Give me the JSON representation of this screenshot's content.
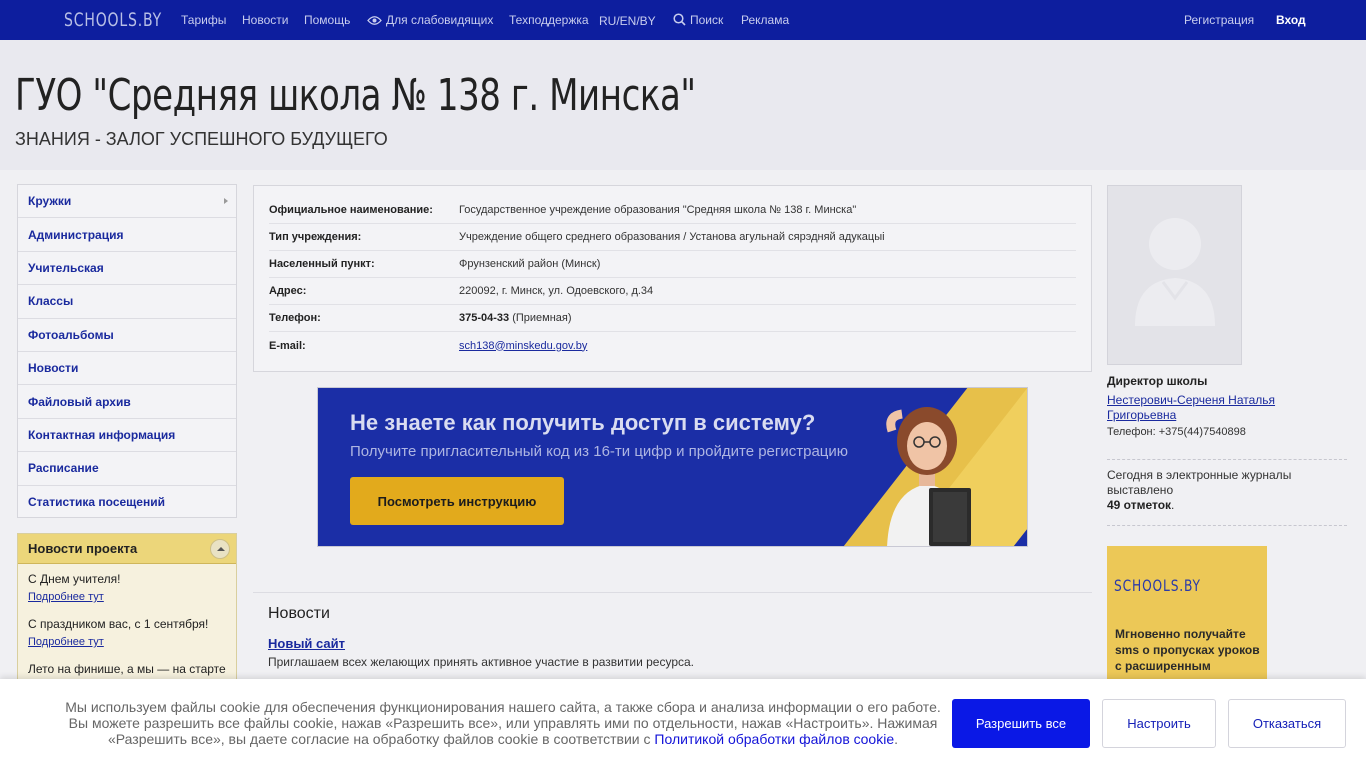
{
  "topbar": {
    "logo": "SCHOOLS.BY",
    "nav": [
      "Тарифы",
      "Новости",
      "Помощь",
      "Для слабовидящих",
      "Техподдержка",
      "RU/EN/BY",
      "Поиск",
      "Реклама"
    ],
    "register": "Регистрация",
    "login": "Вход"
  },
  "header": {
    "title": "ГУО \"Средняя школа № 138 г. Минска\"",
    "motto": "ЗНАНИЯ - ЗАЛОГ УСПЕШНОГО БУДУЩЕГО"
  },
  "sidebar": {
    "items": [
      {
        "label": "Кружки",
        "has_submenu": true
      },
      {
        "label": "Администрация"
      },
      {
        "label": "Учительская"
      },
      {
        "label": "Классы"
      },
      {
        "label": "Фотоальбомы"
      },
      {
        "label": "Новости"
      },
      {
        "label": "Файловый архив"
      },
      {
        "label": "Контактная информация"
      },
      {
        "label": "Расписание"
      },
      {
        "label": "Статистика посещений"
      }
    ]
  },
  "project_news": {
    "title": "Новости проекта",
    "items": [
      {
        "text": "С Днем учителя!",
        "more": "Подробнее тут"
      },
      {
        "text": "С праздником вас, с 1 сентября!",
        "more": "Подробнее тут"
      },
      {
        "text": "Лето на финише, а мы — на старте"
      }
    ]
  },
  "info": {
    "rows": [
      {
        "key": "Официальное наименование:",
        "value": "Государственное учреждение образования \"Средняя школа № 138 г. Минска\""
      },
      {
        "key": "Тип учреждения:",
        "value": "Учреждение общего среднего образования / Установа агульнай сярэдняй адукацыі"
      },
      {
        "key": "Населенный пункт:",
        "value": "Фрунзенский район (Минск)"
      },
      {
        "key": "Адрес:",
        "value": "220092, г. Минск, ул. Одоевского, д.34"
      },
      {
        "key": "Телефон:",
        "value_bold": "375-04-33",
        "value": " (Приемная)"
      },
      {
        "key": "E-mail:",
        "value_link": "sch138@minskedu.gov.by"
      }
    ]
  },
  "banner": {
    "headline": "Не знаете как получить доступ в систему?",
    "subline": "Получите пригласительный код из 16-ти цифр и пройдите регистрацию",
    "button": "Посмотреть инструкцию"
  },
  "news": {
    "heading": "Новости",
    "items": [
      {
        "title": "Новый сайт",
        "text": "Приглашаем всех желающих принять активное участие в развитии ресурса."
      }
    ]
  },
  "director": {
    "label": "Директор школы",
    "name": "Нестерович-Серченя Наталья Григорьевна",
    "phone": "Телефон: +375(44)7540898"
  },
  "stats": {
    "text": "Сегодня в электронные журналы выставлено",
    "count": "49 отметок",
    "suffix": "."
  },
  "ad": {
    "logo": "SCHOOLS.BY",
    "text": "Мгновенно получайте sms о пропусках уроков с расширенным"
  },
  "cookie": {
    "message": "Мы используем файлы cookie для обеспечения функционирования нашего сайта, а также сбора и анализа информации о его работе. Вы можете разрешить все файлы cookie, нажав «Разрешить все», или управлять ими по отдельности, нажав «Настроить». Нажимая «Разрешить все», вы даете согласие на обработку файлов cookie в соответствии с ",
    "policy_link": "Политикой обработки файлов cookie",
    "end": ".",
    "allow": "Разрешить все",
    "configure": "Настроить",
    "refuse": "Отказаться"
  },
  "colors": {
    "topbar": "#0d1e9e",
    "link": "#1a2a9e",
    "accent_yellow": "#ecd67a",
    "primary_button": "#0a18e6"
  }
}
